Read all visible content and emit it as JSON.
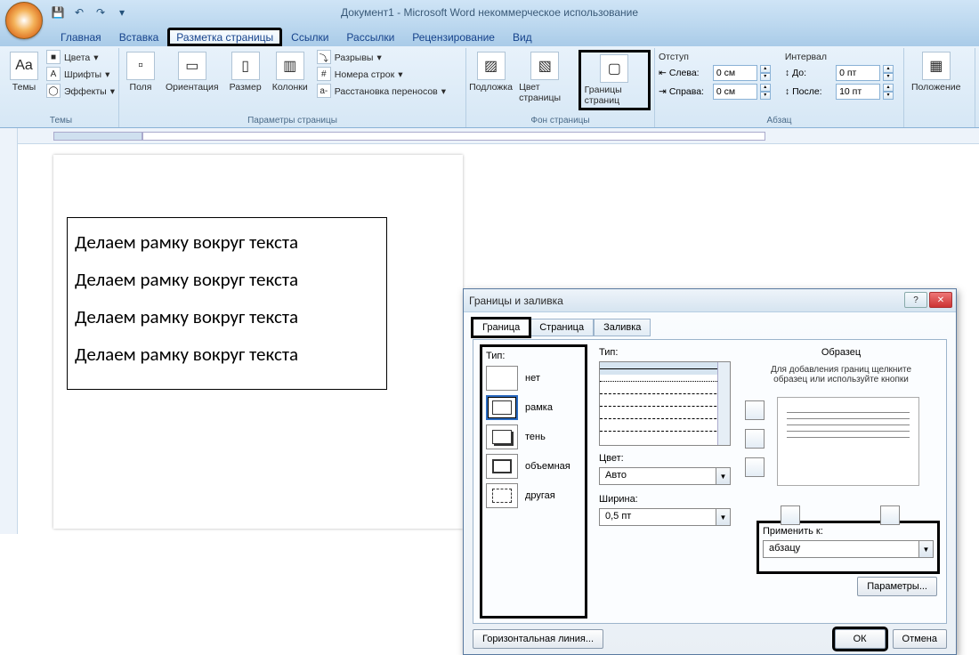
{
  "titlebar": {
    "title": "Документ1 - Microsoft Word некоммерческое использование"
  },
  "qat": {
    "save": "💾",
    "undo": "↶",
    "redo": "↷"
  },
  "tabs": {
    "home": "Главная",
    "insert": "Вставка",
    "pagelayout": "Разметка страницы",
    "references": "Ссылки",
    "mailings": "Рассылки",
    "review": "Рецензирование",
    "view": "Вид"
  },
  "ribbon": {
    "themes": {
      "label": "Темы",
      "themes_btn": "Темы",
      "colors": "Цвета",
      "fonts": "Шрифты",
      "effects": "Эффекты"
    },
    "page_setup": {
      "label": "Параметры страницы",
      "margins": "Поля",
      "orientation": "Ориентация",
      "size": "Размер",
      "columns": "Колонки",
      "breaks": "Разрывы",
      "line_numbers": "Номера строк",
      "hyphenation": "Расстановка переносов"
    },
    "page_bg": {
      "label": "Фон страницы",
      "watermark": "Подложка",
      "page_color": "Цвет страницы",
      "page_borders": "Границы страниц"
    },
    "paragraph": {
      "label": "Абзац",
      "indent_label": "Отступ",
      "spacing_label": "Интервал",
      "left": "Слева:",
      "left_val": "0 см",
      "right": "Справа:",
      "right_val": "0 см",
      "before": "До:",
      "before_val": "0 пт",
      "after": "После:",
      "after_val": "10 пт"
    },
    "arrange": {
      "label": "",
      "position": "Положение"
    }
  },
  "document": {
    "lines": [
      "Делаем рамку вокруг текста",
      "Делаем рамку вокруг текста",
      "Делаем рамку вокруг текста",
      "Делаем рамку вокруг текста"
    ]
  },
  "dialog": {
    "title": "Границы и заливка",
    "tabs": {
      "border": "Граница",
      "page": "Страница",
      "shading": "Заливка"
    },
    "type_label": "Тип:",
    "types": {
      "none": "нет",
      "box": "рамка",
      "shadow": "тень",
      "threeD": "объемная",
      "custom": "другая"
    },
    "style_label": "Тип:",
    "color_label": "Цвет:",
    "color_val": "Авто",
    "width_label": "Ширина:",
    "width_val": "0,5 пт",
    "preview_label": "Образец",
    "preview_hint": "Для добавления границ щелкните образец или используйте кнопки",
    "apply_label": "Применить к:",
    "apply_val": "абзацу",
    "params": "Параметры...",
    "hr_line": "Горизонтальная линия...",
    "ok": "ОК",
    "cancel": "Отмена",
    "help": "?"
  }
}
